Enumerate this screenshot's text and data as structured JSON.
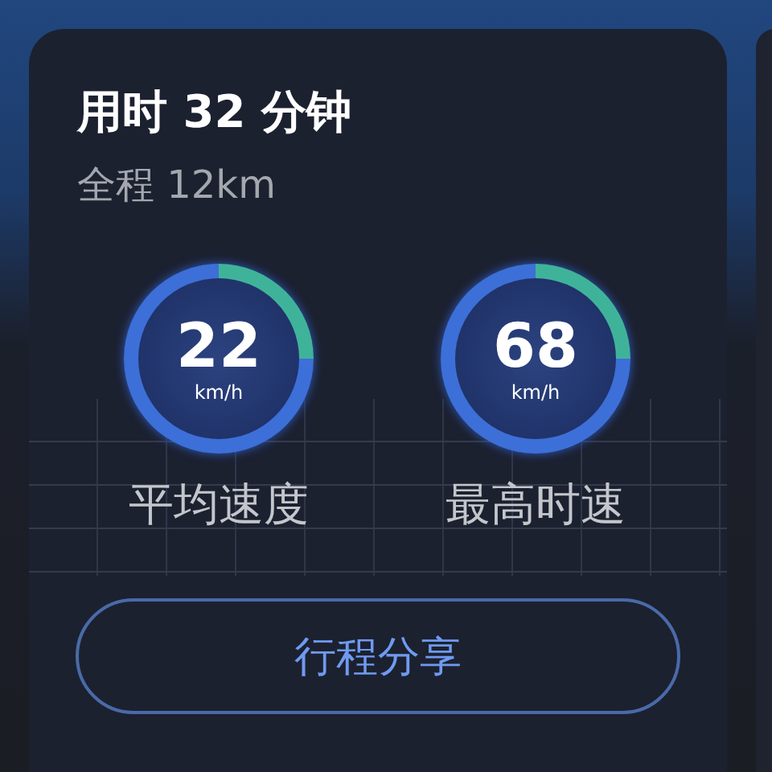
{
  "card": {
    "title": "用时 32 分钟",
    "subtitle": "全程 12km"
  },
  "stats": [
    {
      "value": "22",
      "unit": "km/h",
      "label": "平均速度"
    },
    {
      "value": "68",
      "unit": "km/h",
      "label": "最高时速"
    }
  ],
  "share_button": "行程分享"
}
